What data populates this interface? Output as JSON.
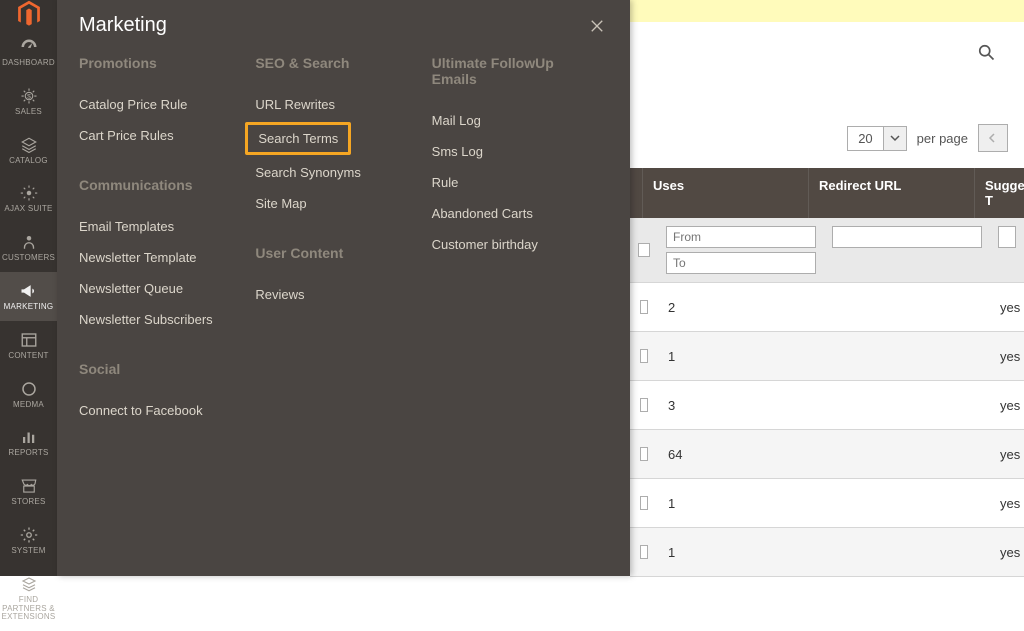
{
  "brand_color": "#ef672f",
  "nav": [
    {
      "id": "dashboard",
      "label": "DASHBOARD"
    },
    {
      "id": "sales",
      "label": "SALES"
    },
    {
      "id": "catalog",
      "label": "CATALOG"
    },
    {
      "id": "ajaxsuite",
      "label": "AJAX SUITE"
    },
    {
      "id": "customers",
      "label": "CUSTOMERS"
    },
    {
      "id": "marketing",
      "label": "MARKETING",
      "active": true
    },
    {
      "id": "content",
      "label": "CONTENT"
    },
    {
      "id": "medma",
      "label": "MEDMA"
    },
    {
      "id": "reports",
      "label": "REPORTS"
    },
    {
      "id": "stores",
      "label": "STORES"
    },
    {
      "id": "system",
      "label": "SYSTEM"
    },
    {
      "id": "partners",
      "label": "FIND PARTNERS & EXTENSIONS"
    }
  ],
  "flyout": {
    "title": "Marketing",
    "columns": [
      {
        "groups": [
          {
            "title": "Promotions",
            "items": [
              "Catalog Price Rule",
              "Cart Price Rules"
            ]
          },
          {
            "title": "Communications",
            "items": [
              "Email Templates",
              "Newsletter Template",
              "Newsletter Queue",
              "Newsletter Subscribers"
            ]
          },
          {
            "title": "Social",
            "items": [
              "Connect to Facebook"
            ]
          }
        ]
      },
      {
        "groups": [
          {
            "title": "SEO & Search",
            "items": [
              "URL Rewrites",
              "Search Terms",
              "Search Synonyms",
              "Site Map"
            ],
            "highlight_index": 1
          },
          {
            "title": "User Content",
            "items": [
              "Reviews"
            ]
          }
        ]
      },
      {
        "groups": [
          {
            "title": "Ultimate FollowUp Emails",
            "items": [
              "Mail Log",
              "Sms Log",
              "Rule",
              "Abandoned Carts",
              "Customer birthday"
            ]
          }
        ]
      }
    ]
  },
  "toolbar": {
    "per_page_value": "20",
    "per_page_label": "per page"
  },
  "table": {
    "headers": {
      "uses": "Uses",
      "redirect": "Redirect URL",
      "suggested": "Suggested T"
    },
    "filter_placeholders": {
      "from": "From",
      "to": "To"
    },
    "rows": [
      {
        "uses": "2",
        "redirect": "",
        "suggested": "yes"
      },
      {
        "uses": "1",
        "redirect": "",
        "suggested": "yes"
      },
      {
        "uses": "3",
        "redirect": "",
        "suggested": "yes"
      },
      {
        "uses": "64",
        "redirect": "",
        "suggested": "yes"
      },
      {
        "uses": "1",
        "redirect": "",
        "suggested": "yes"
      },
      {
        "uses": "1",
        "redirect": "",
        "suggested": "yes"
      }
    ]
  }
}
